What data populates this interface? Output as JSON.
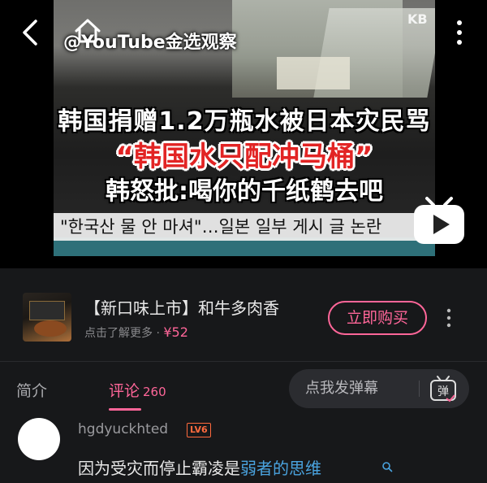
{
  "video": {
    "watermark": "@YouTube金选观察",
    "channel_logo": "KB",
    "headline_line1": "韩国捐赠1.2万瓶水被日本灾民骂",
    "headline_line2": "“韩国水只配冲马桶”",
    "headline_line3": "韩怒批:喝你的千纸鹤去吧",
    "ticker_text": "\"한국산 물 안 마셔\"…일본 일부 게시 글 논란",
    "icons": [
      "back-arrow-icon",
      "home-icon",
      "more-vertical-icon",
      "tv-play-icon"
    ]
  },
  "ad": {
    "title": "【新口味上市】和牛多肉香",
    "subtitle": "点击了解更多 · ",
    "price": "¥52",
    "buy_label": "立即购买"
  },
  "tabs": {
    "intro": "简介",
    "comments": "评论",
    "comments_count": "260",
    "active": "comments"
  },
  "danmaku": {
    "placeholder": "点我发弹幕",
    "button_icon": "弹"
  },
  "comment": {
    "username": "hgdyuckhted",
    "level": "LV6",
    "text_plain": "因为受灾而停止霸凌是",
    "text_link": "弱者的思维"
  },
  "colors": {
    "background": "#17181a",
    "accent_pink": "#ff6699",
    "link_blue": "#4aa3df",
    "level_orange": "#ff6a3d",
    "headline_red": "#e22424"
  }
}
